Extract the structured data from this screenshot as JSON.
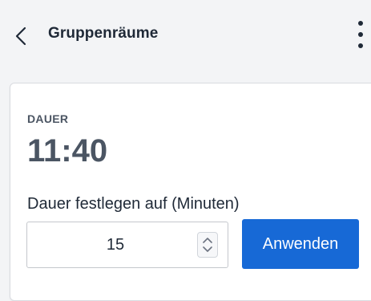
{
  "header": {
    "back_icon": "chevron-left-icon",
    "title": "Gruppenräume",
    "menu_icon": "more-vertical-icon"
  },
  "duration": {
    "section_label": "DAUER",
    "value": "11:40",
    "field_label": "Dauer festlegen auf (Minuten)",
    "input_value": "15",
    "stepper_icon": "updown-spinner-icon",
    "apply_label": "Anwenden"
  },
  "colors": {
    "accent": "#1769d6",
    "text_dark": "#1f2937",
    "text_muted": "#4b5563",
    "page_bg": "#f3f4f6"
  }
}
